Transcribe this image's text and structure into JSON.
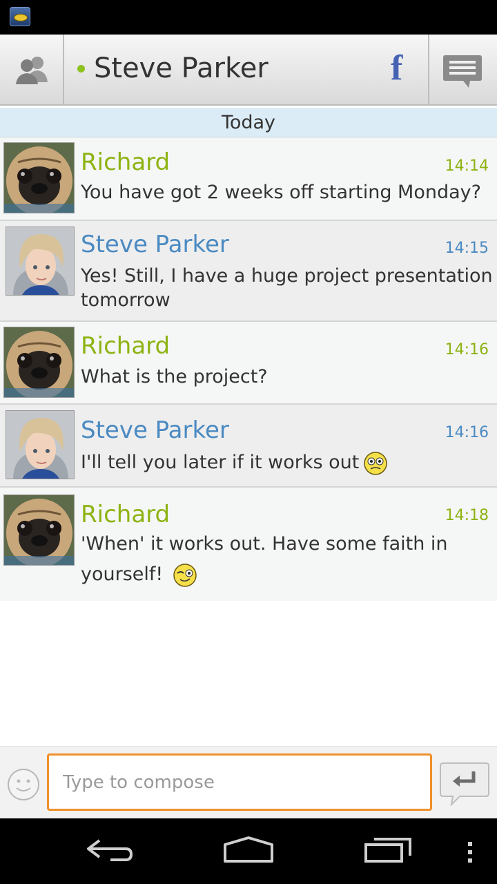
{
  "header": {
    "contact_name": "Steve Parker",
    "facebook_glyph": "f",
    "online_color": "#8dc21f"
  },
  "date_separator": "Today",
  "messages": [
    {
      "sender": "Richard",
      "time": "14:14",
      "text": "You have got 2 weeks off starting Monday?",
      "avatar": "pug"
    },
    {
      "sender": "Steve Parker",
      "time": "14:15",
      "text": "Yes! Still, I have a huge project presentation tomorrow",
      "avatar": "steve"
    },
    {
      "sender": "Richard",
      "time": "14:16",
      "text": "What is the project?",
      "avatar": "pug"
    },
    {
      "sender": "Steve Parker",
      "time": "14:16",
      "text": "I'll tell you later if it works out",
      "avatar": "steve",
      "emoji": "nervous-smiley"
    },
    {
      "sender": "Richard",
      "time": "14:18",
      "text": "'When'  it works out.  Have some faith in yourself!",
      "avatar": "pug",
      "emoji": "winking-smiley"
    }
  ],
  "compose": {
    "placeholder": "Type to compose"
  },
  "colors": {
    "richard": "#8db312",
    "steve": "#4a8ac2",
    "compose_border": "#f0902a"
  }
}
